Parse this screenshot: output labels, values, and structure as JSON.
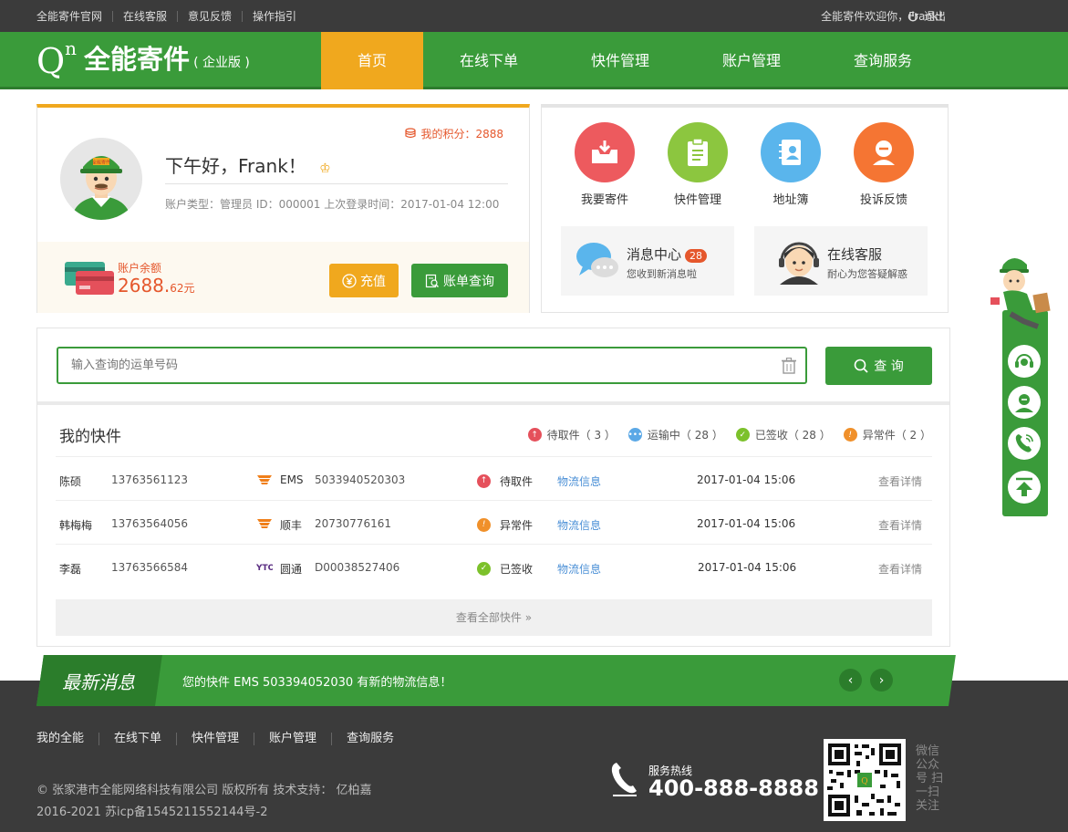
{
  "topbar": {
    "links": [
      "全能寄件官网",
      "在线客服",
      "意见反馈",
      "操作指引"
    ],
    "welcome": "全能寄件欢迎你，Frank！",
    "logout": "退出"
  },
  "logo": {
    "q": "Q",
    "n": "n",
    "name": "全能寄件",
    "edition": "( 企业版 )"
  },
  "nav": [
    "首页",
    "在线下单",
    "快件管理",
    "账户管理",
    "查询服务"
  ],
  "user": {
    "greeting": "下午好，Frank！",
    "points": "我的积分：2888",
    "account_info": "账户类型：管理员 ID：000001 上次登录时间：2017-01-04 12:00",
    "balance_label": "账户余额",
    "balance_int": "2688.",
    "balance_dec": "62元",
    "recharge": "充值",
    "bill": "账单查询",
    "avatar_sign": "全能寄件"
  },
  "quick": {
    "items": [
      "我要寄件",
      "快件管理",
      "地址簿",
      "投诉反馈"
    ],
    "msg_title": "消息中心",
    "msg_badge": "28",
    "msg_sub": "您收到新消息啦",
    "cs_title": "在线客服",
    "cs_sub": "耐心为您答疑解惑"
  },
  "search": {
    "placeholder": "输入查询的运单号码",
    "button": "查 询"
  },
  "list": {
    "title": "我的快件",
    "stats": [
      {
        "label": "待取件（ 3 ）",
        "color": "#e5505b"
      },
      {
        "label": "运输中（ 28 ）",
        "color": "#5ba8e6"
      },
      {
        "label": "已签收（ 28 ）",
        "color": "#7cc12b"
      },
      {
        "label": "异常件（ 2 ）",
        "color": "#f0902a"
      }
    ],
    "rows": [
      {
        "name": "陈硕",
        "phone": "13763561123",
        "carrier": "EMS",
        "tracking": "5033940520303",
        "status": "待取件",
        "logistics": "物流信息",
        "time": "2017-01-04 15:06",
        "detail": "查看详情"
      },
      {
        "name": "韩梅梅",
        "phone": "13763564056",
        "carrier": "顺丰",
        "tracking": "20730776161",
        "status": "异常件",
        "logistics": "物流信息",
        "time": "2017-01-04 15:06",
        "detail": "查看详情"
      },
      {
        "name": "李磊",
        "phone": "13763566584",
        "carrier": "圆通",
        "tracking": "D00038527406",
        "status": "已签收",
        "logistics": "物流信息",
        "time": "2017-01-04 15:06",
        "detail": "查看详情"
      }
    ],
    "view_all": "查看全部快件"
  },
  "news": {
    "label": "最新消息",
    "text": "您的快件 EMS 503394052030 有新的物流信息！"
  },
  "footer": {
    "links": [
      "我的全能",
      "在线下单",
      "快件管理",
      "账户管理",
      "查询服务"
    ],
    "copyright": "© 张家港市全能网络科技有限公司 版权所有 技术支持： 亿柏嘉",
    "icp": "2016-2021 苏icp备1545211552144号-2",
    "hotline_label": "服务热线",
    "hotline": "400-888-8888",
    "wechat": "微信公众号 扫一扫关注"
  },
  "colors": {
    "brand_green": "#3a9b3a",
    "accent_orange": "#f0a81e",
    "alert_red": "#e5572c"
  }
}
